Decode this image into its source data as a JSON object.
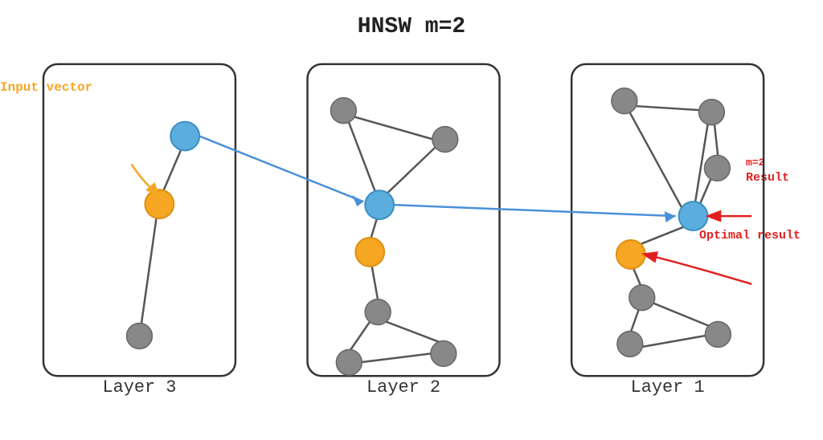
{
  "title": "HNSW m=2",
  "labels": {
    "input_vector": "Input vector",
    "result": "Result",
    "optimal_result": "Optimal result",
    "m2": "m=2",
    "layer3": "Layer 3",
    "layer2": "Layer 2",
    "layer1": "Layer 1"
  },
  "colors": {
    "gray_node": "#888888",
    "blue_node": "#5badde",
    "orange_node": "#f5a623",
    "box_border": "#333333",
    "edge_dark": "#555555",
    "edge_blue": "#4a90d9",
    "edge_red": "#e02020",
    "text_orange": "#f5a623",
    "text_red": "#e02020",
    "text_dark": "#222222"
  }
}
